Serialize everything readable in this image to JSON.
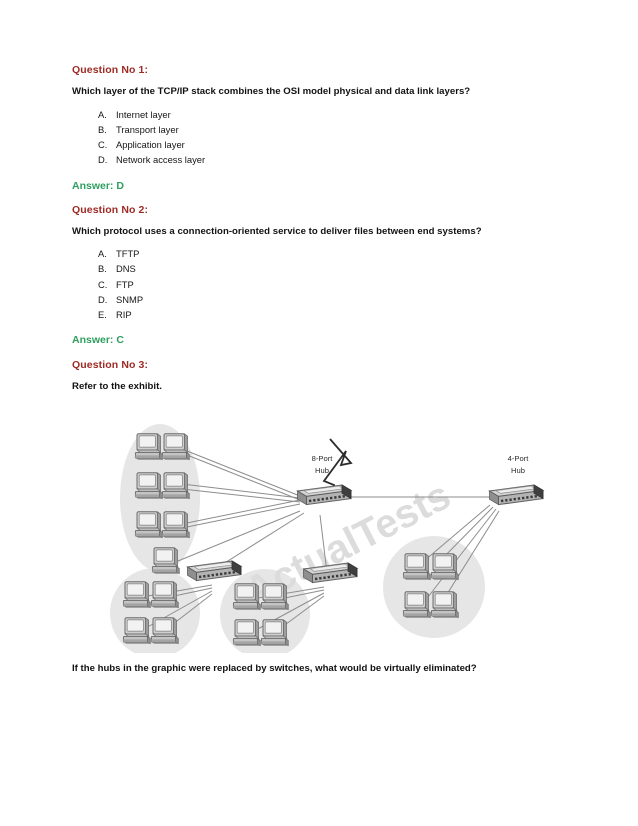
{
  "document": {
    "type": "exam-question-sheet",
    "background_color": "#ffffff",
    "heading_color": "#9e2a23",
    "answer_color": "#2f9e5f",
    "body_color": "#121212"
  },
  "questions": [
    {
      "heading": "Question No 1:",
      "stem": "Which layer of the TCP/IP stack combines the OSI model physical and data link layers?",
      "options": [
        {
          "letter": "A.",
          "text": "Internet layer"
        },
        {
          "letter": "B.",
          "text": "Transport layer"
        },
        {
          "letter": "C.",
          "text": "Application layer"
        },
        {
          "letter": "D.",
          "text": "Network access layer"
        }
      ],
      "answer": "Answer: D"
    },
    {
      "heading": "Question No 2:",
      "stem": "Which protocol uses a connection-oriented service to deliver files between end systems?",
      "options": [
        {
          "letter": "A.",
          "text": "TFTP"
        },
        {
          "letter": "B.",
          "text": "DNS"
        },
        {
          "letter": "C.",
          "text": "FTP"
        },
        {
          "letter": "D.",
          "text": "SNMP"
        },
        {
          "letter": "E.",
          "text": "RIP"
        }
      ],
      "answer": "Answer: C"
    },
    {
      "heading": "Question No 3:",
      "stem": "Refer to the exhibit.",
      "closing": "If the hubs in the graphic were replaced by switches, what would be virtually eliminated?"
    }
  ],
  "exhibit": {
    "watermark": "ActualTests",
    "labels": {
      "hub_8_line1": "8-Port",
      "hub_8_line2": "Hub",
      "hub_4_line1": "4-Port",
      "hub_4_line2": "Hub"
    },
    "devices": {
      "hubs": [
        {
          "id": "hub-8-port",
          "label": "8-Port Hub",
          "labeled": true
        },
        {
          "id": "hub-4-port",
          "label": "4-Port Hub",
          "labeled": true
        },
        {
          "id": "hub-lower-left",
          "label": "",
          "labeled": false
        },
        {
          "id": "hub-lower-middle",
          "label": "",
          "labeled": false
        }
      ],
      "pc_clusters": [
        {
          "id": "cluster-top-left",
          "shape": "ellipse",
          "pc_count": 7
        },
        {
          "id": "cluster-right",
          "shape": "circle",
          "pc_count": 4
        },
        {
          "id": "cluster-bottom-left",
          "shape": "circle",
          "pc_count": 4
        },
        {
          "id": "cluster-bottom-middle",
          "shape": "circle",
          "pc_count": 4
        }
      ],
      "wan_link": {
        "id": "serial-wan-link",
        "style": "lightning-bolt"
      }
    },
    "colors": {
      "cluster_fill": "#e6e6e6",
      "device_body": "#b9b9b9",
      "device_top": "#d6d6d6",
      "device_dark": "#4a4a4a",
      "line": "#8d8d8d",
      "label_text": "#2b2b2b",
      "watermark": "#dcdcdc"
    }
  }
}
